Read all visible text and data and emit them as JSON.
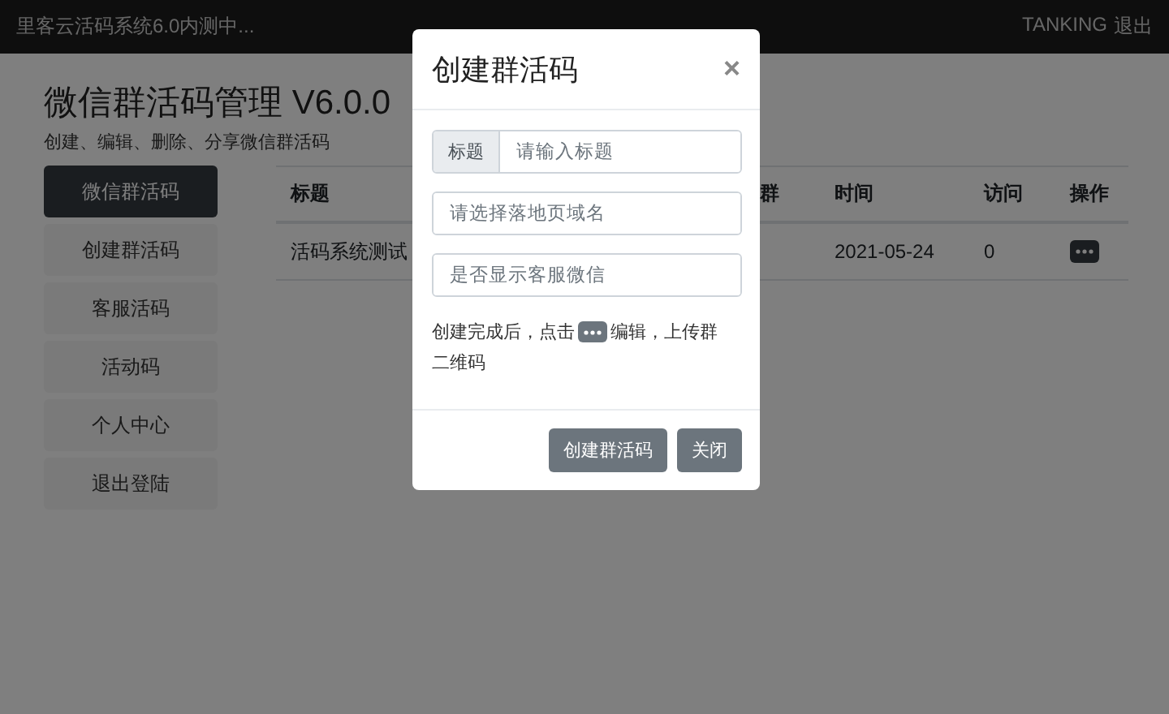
{
  "top_bar": {
    "title": "里客云活码系统6.0内测中...",
    "user": "TANKING",
    "logout": "退出"
  },
  "page": {
    "heading": "微信群活码管理 V6.0.0",
    "subtitle": "创建、编辑、删除、分享微信群活码"
  },
  "sidebar": {
    "items": [
      {
        "label": "微信群活码",
        "selected": true
      },
      {
        "label": "创建群活码",
        "selected": false
      },
      {
        "label": "客服活码",
        "selected": false
      },
      {
        "label": "活动码",
        "selected": false
      },
      {
        "label": "个人中心",
        "selected": false
      },
      {
        "label": "退出登陆",
        "selected": false
      }
    ]
  },
  "table": {
    "columns": [
      "标题",
      "群",
      "时间",
      "访问",
      "操作"
    ],
    "rows": [
      {
        "title": "活码系统测试",
        "time": "2021-05-24",
        "visits": "0"
      }
    ]
  },
  "modal": {
    "title": "创建群活码",
    "close": "×",
    "fields": [
      {
        "kind": "addon",
        "addon": "标题",
        "placeholder": "请输入标题"
      },
      {
        "kind": "select",
        "placeholder": "请选择落地页域名"
      },
      {
        "kind": "select",
        "placeholder": "是否显示客服微信"
      }
    ],
    "note": {
      "before": "创建完成后，点击",
      "after": "编辑，上传群",
      "second_line": "二维码"
    },
    "buttons": [
      "创建群活码",
      "关闭"
    ]
  }
}
